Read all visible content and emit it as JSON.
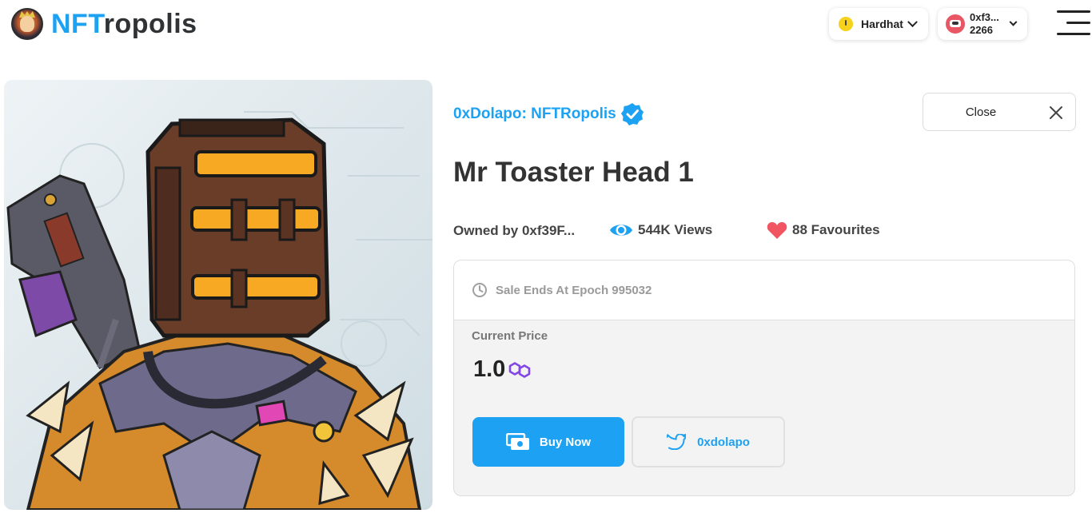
{
  "brand": {
    "name_accent": "NFT",
    "name_rest": "ropolis",
    "accent_color": "#1da1f2"
  },
  "header": {
    "network": {
      "label": "Hardhat",
      "icon": "warning-icon"
    },
    "account": {
      "address": "0xf3...",
      "balance": "2266",
      "icon": "account-avatar"
    },
    "menu_icon": "hamburger-icon"
  },
  "item": {
    "collection": "0xDolapo: NFTRopolis",
    "verified": true,
    "title": "Mr Toaster Head 1",
    "image_subject": "toaster-head-character",
    "owner": "Owned by 0xf39F...",
    "views": "544K Views",
    "favourites": "88 Favourites"
  },
  "close_button": {
    "label": "Close"
  },
  "sale": {
    "ends_text": "Sale Ends At Epoch 995032",
    "price_label": "Current Price",
    "price": "1.0",
    "currency_icon": "polygon-matic-icon",
    "buy_label": "Buy Now",
    "twitter_label": "0xdolapo"
  },
  "colors": {
    "primary": "#1da1f2",
    "heart": "#f05561",
    "polygon": "#8247e5"
  }
}
